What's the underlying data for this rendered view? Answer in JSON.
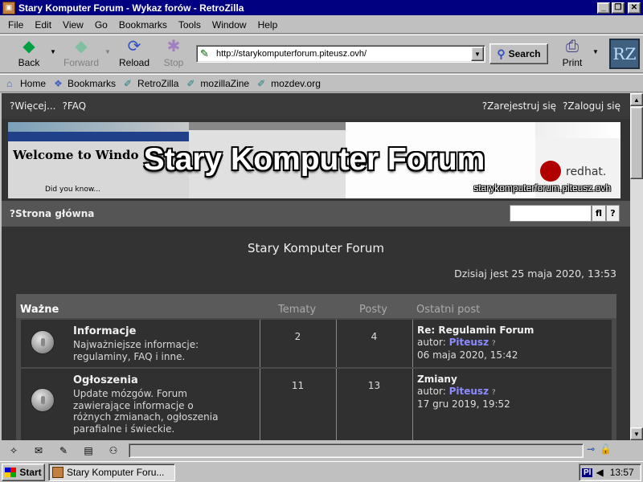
{
  "window": {
    "title": "Stary Komputer Forum - Wykaz forów - RetroZilla",
    "minimize_glyph": "_",
    "maximize_glyph": "❐",
    "close_glyph": "✕"
  },
  "menu": [
    "File",
    "Edit",
    "View",
    "Go",
    "Bookmarks",
    "Tools",
    "Window",
    "Help"
  ],
  "toolbar": {
    "back_label": "Back",
    "forward_label": "Forward",
    "reload_label": "Reload",
    "stop_label": "Stop",
    "url": "http://starykomputerforum.piteusz.ovh/",
    "search_label": "Search",
    "print_label": "Print",
    "logo_text": "RZ"
  },
  "bookmarks": [
    {
      "label": "Home",
      "icon": "home-icon"
    },
    {
      "label": "Bookmarks",
      "icon": "bookmarks-icon"
    },
    {
      "label": "RetroZilla",
      "icon": "bookmark-link-icon"
    },
    {
      "label": "mozillaZine",
      "icon": "bookmark-link-icon"
    },
    {
      "label": "mozdev.org",
      "icon": "bookmark-link-icon"
    }
  ],
  "forum": {
    "top_links_left": [
      "?Więcej...",
      "?FAQ"
    ],
    "top_links_right": [
      "?Zarejestruj się",
      "?Zaloguj się"
    ],
    "banner_title": "Stary Komputer Forum",
    "banner_url": "starykomputerforum.piteusz.ovh",
    "banner_welcome": "Welcome to Windo",
    "banner_didyouknow": "Did you know...",
    "banner_redhat": "redhat.",
    "nav_home": "?Strona główna",
    "search_btn": "fl",
    "adv_search_btn": "?",
    "site_name": "Stary Komputer Forum",
    "date_line": "Dzisiaj jest 25 maja 2020, 13:53",
    "category": {
      "name": "Ważne",
      "col_topics": "Tematy",
      "col_posts": "Posty",
      "col_last": "Ostatni post"
    },
    "rows": [
      {
        "name": "Informacje",
        "description": "Najważniejsze informacje: regulaminy, FAQ i inne.",
        "topics": "2",
        "posts": "4",
        "last_title": "Re: Regulamin Forum",
        "author_prefix": "autor: ",
        "author": "Piteusz",
        "go": "?",
        "last_date": "06 maja 2020, 15:42"
      },
      {
        "name": "Ogłoszenia",
        "description": "Update mózgów. Forum zawierające informacje o różnych zmianach, ogłoszenia parafialne i świeckie.",
        "topics": "11",
        "posts": "13",
        "last_title": "Zmiany",
        "author_prefix": "autor: ",
        "author": "Piteusz",
        "go": "?",
        "last_date": "17 gru 2019, 19:52"
      }
    ]
  },
  "taskbar": {
    "start_label": "Start",
    "task_label": "Stary Komputer Foru...",
    "lang": "Pl",
    "clock": "13:57"
  }
}
